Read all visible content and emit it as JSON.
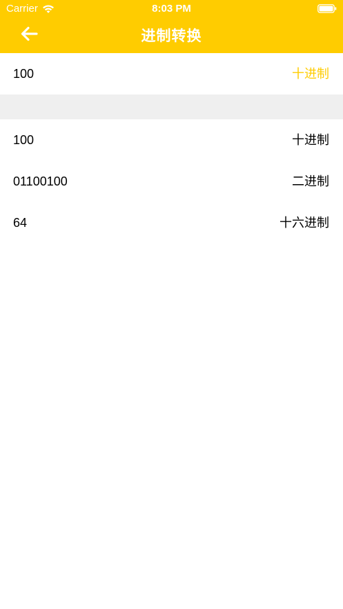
{
  "status_bar": {
    "carrier": "Carrier",
    "time": "8:03 PM",
    "icons": [
      "wifi-icon",
      "battery-icon"
    ]
  },
  "nav": {
    "title": "进制转换",
    "back_icon": "arrow-left-icon"
  },
  "input": {
    "value": "100",
    "base_label": "十进制"
  },
  "results": [
    {
      "value": "100",
      "base_label": "十进制"
    },
    {
      "value": "01100100",
      "base_label": "二进制"
    },
    {
      "value": "64",
      "base_label": "十六进制"
    }
  ],
  "colors": {
    "accent": "#ffcc00",
    "separator": "#efefef",
    "text": "#000000",
    "nav_text": "#ffffff"
  }
}
